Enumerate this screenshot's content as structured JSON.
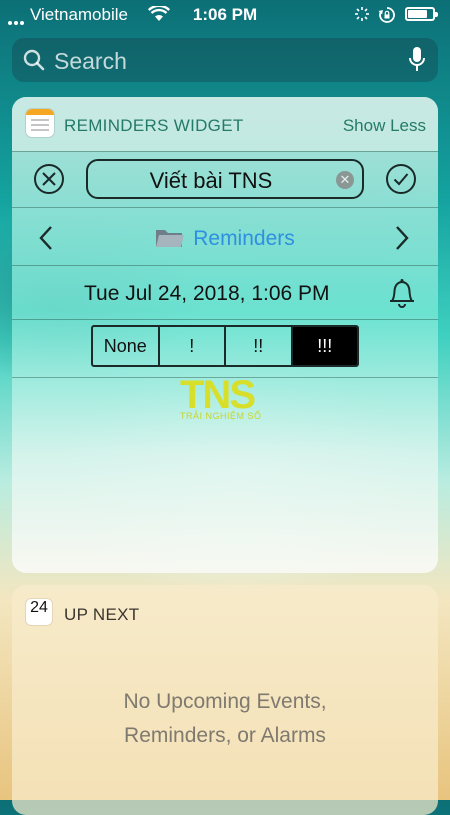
{
  "status_bar": {
    "carrier": "Vietnamobile",
    "time": "1:06 PM",
    "battery_level": 0.8
  },
  "search": {
    "placeholder": "Search"
  },
  "reminders_widget": {
    "title": "REMINDERS WIDGET",
    "show_less_label": "Show Less",
    "reminder_title": "Viết bài TNS",
    "list_name": "Reminders",
    "due_date": "Tue Jul 24, 2018, 1:06 PM",
    "priority_options": [
      "None",
      "!",
      "!!",
      "!!!"
    ],
    "selected_priority": "!!!"
  },
  "watermark": {
    "logo": "TNS",
    "tagline": "TRẢI NGHIỆM SỐ"
  },
  "up_next": {
    "icon_day": "24",
    "title": "UP NEXT",
    "empty_line1": "No Upcoming Events,",
    "empty_line2": "Reminders, or Alarms"
  },
  "colors": {
    "accent": "#2f8fe0",
    "widget_header_text": "#247a68",
    "selected_segment": "#000000"
  }
}
